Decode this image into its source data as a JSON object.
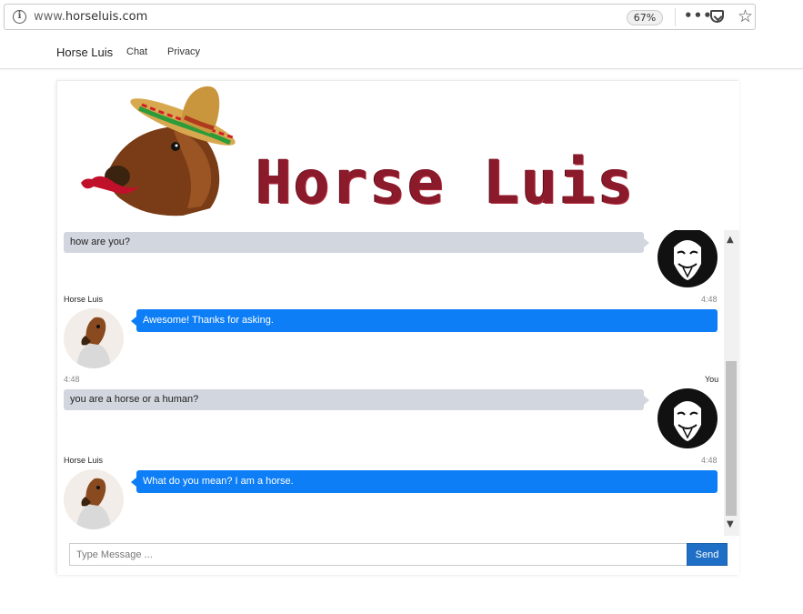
{
  "browser": {
    "url_prefix": "www.",
    "url_domain": "horseluis.com",
    "zoom": "67%",
    "menu_dots": "•••"
  },
  "navbar": {
    "brand": "Horse Luis",
    "links": [
      "Chat",
      "Privacy"
    ]
  },
  "banner": {
    "logo_text": "Horse Luis"
  },
  "messages": [
    {
      "sender": "user",
      "text": "how are you?"
    },
    {
      "sender": "bot",
      "name": "Horse Luis",
      "time": "4:48",
      "text": "Awesome! Thanks for asking."
    },
    {
      "sender": "user",
      "name": "You",
      "time": "4:48",
      "text": "you are a horse or a human?"
    },
    {
      "sender": "bot",
      "name": "Horse Luis",
      "time": "4:48",
      "text": "What do you mean? I am a horse."
    }
  ],
  "composer": {
    "placeholder": "Type Message ...",
    "send_label": "Send"
  },
  "colors": {
    "bot_bubble": "#0d7ef5",
    "user_bubble": "#d2d6de",
    "send_button": "#1f6fc6",
    "logo": "#8b1a2b"
  }
}
